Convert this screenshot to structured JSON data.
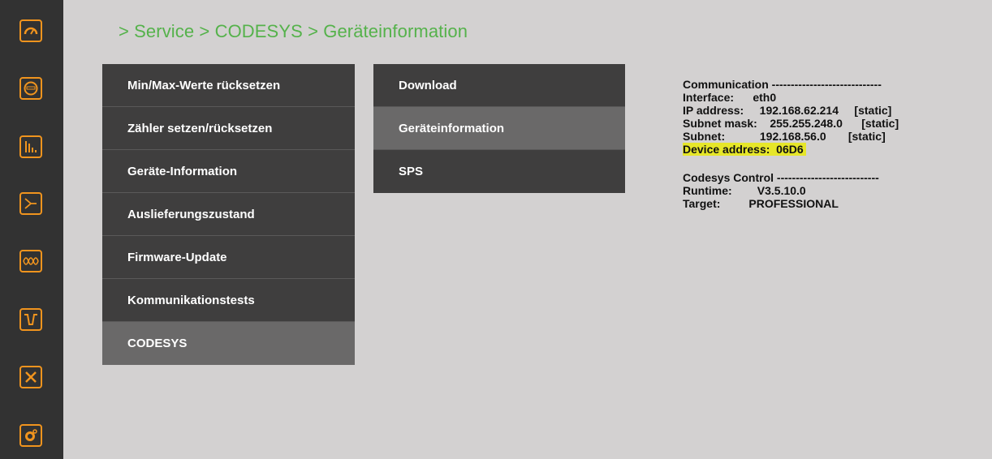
{
  "breadcrumb": "> Service > CODESYS > Geräteinformation",
  "sidebar": {
    "icons": [
      "gauge-icon",
      "meter-icon",
      "bar-chart-icon",
      "topology-icon",
      "waveform-icon",
      "dip-icon",
      "tools-icon",
      "settings-icon"
    ]
  },
  "menu_primary": [
    {
      "label": "Min/Max-Werte rücksetzen",
      "active": false
    },
    {
      "label": "Zähler setzen/rücksetzen",
      "active": false
    },
    {
      "label": "Geräte-Information",
      "active": false
    },
    {
      "label": "Auslieferungszustand",
      "active": false
    },
    {
      "label": "Firmware-Update",
      "active": false
    },
    {
      "label": "Kommunikationstests",
      "active": false
    },
    {
      "label": "CODESYS",
      "active": true
    }
  ],
  "menu_secondary": [
    {
      "label": "Download",
      "active": false
    },
    {
      "label": "Geräteinformation",
      "active": true
    },
    {
      "label": "SPS",
      "active": false
    }
  ],
  "info": {
    "communication_header": "Communication -----------------------------",
    "interface": "Interface:      eth0",
    "ip": "IP address:     192.168.62.214     [static]",
    "subnet_mask": "Subnet mask:    255.255.248.0      [static]",
    "subnet": "Subnet:           192.168.56.0       [static]",
    "device_address": "Device address:  06D6",
    "codesys_header": "Codesys Control ---------------------------",
    "runtime": "Runtime:        V3.5.10.0",
    "target": "Target:         PROFESSIONAL"
  },
  "colors": {
    "accent": "#f0941e",
    "breadcrumb": "#55b24b",
    "highlight": "#e6e629"
  }
}
